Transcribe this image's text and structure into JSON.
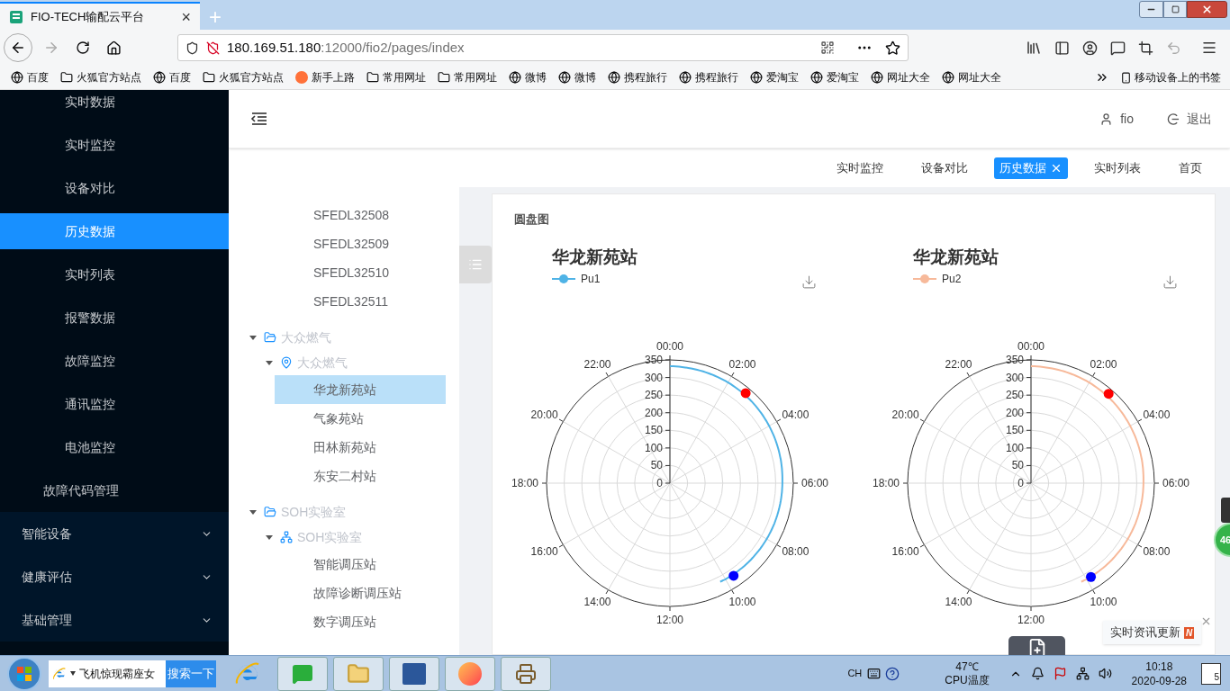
{
  "browser": {
    "tab": {
      "title": "FIO-TECH输配云平台",
      "close": "×"
    },
    "new_tab": "+",
    "url": {
      "host": "180.169.51.180",
      "path": ":12000/fio2/pages/index"
    },
    "bookmarks": [
      {
        "label": "百度",
        "kind": "globe"
      },
      {
        "label": "火狐官方站点",
        "kind": "folder"
      },
      {
        "label": "百度",
        "kind": "globe"
      },
      {
        "label": "火狐官方站点",
        "kind": "folder"
      },
      {
        "label": "新手上路",
        "kind": "firefox"
      },
      {
        "label": "常用网址",
        "kind": "folder"
      },
      {
        "label": "常用网址",
        "kind": "folder"
      },
      {
        "label": "微博",
        "kind": "globe"
      },
      {
        "label": "微博",
        "kind": "globe"
      },
      {
        "label": "携程旅行",
        "kind": "globe"
      },
      {
        "label": "携程旅行",
        "kind": "globe"
      },
      {
        "label": "爱淘宝",
        "kind": "globe"
      },
      {
        "label": "爱淘宝",
        "kind": "globe"
      },
      {
        "label": "网址大全",
        "kind": "globe"
      },
      {
        "label": "网址大全",
        "kind": "globe"
      }
    ],
    "mobile_bookmarks": "移动设备上的书签"
  },
  "sidebar": {
    "items": [
      {
        "label": "实时数据",
        "kind": "sub-item",
        "selected": false
      },
      {
        "label": "实时监控",
        "kind": "sub-item",
        "selected": false
      },
      {
        "label": "设备对比",
        "kind": "sub-item",
        "selected": false
      },
      {
        "label": "历史数据",
        "kind": "sub-item",
        "selected": true
      },
      {
        "label": "实时列表",
        "kind": "sub-item",
        "selected": false
      },
      {
        "label": "报警数据",
        "kind": "sub-item",
        "selected": false
      },
      {
        "label": "故障监控",
        "kind": "sub-item",
        "selected": false
      },
      {
        "label": "通讯监控",
        "kind": "sub-item",
        "selected": false
      },
      {
        "label": "电池监控",
        "kind": "sub-item",
        "selected": false
      },
      {
        "label": "故障代码管理",
        "kind": "item",
        "selected": false
      },
      {
        "label": "智能设备",
        "kind": "menu",
        "selected": false,
        "expanded": false
      },
      {
        "label": "健康评估",
        "kind": "menu",
        "selected": false,
        "expanded": false
      },
      {
        "label": "基础管理",
        "kind": "menu",
        "selected": false,
        "expanded": false
      }
    ]
  },
  "header": {
    "user": "fio",
    "logout": "退出"
  },
  "tags": [
    {
      "label": "实时监控",
      "selected": false
    },
    {
      "label": "设备对比",
      "selected": false
    },
    {
      "label": "历史数据",
      "selected": true
    },
    {
      "label": "实时列表",
      "selected": false
    },
    {
      "label": "首页",
      "selected": false
    }
  ],
  "tree": [
    {
      "label": "SFEDL32508",
      "kind": "leaf",
      "selected": false
    },
    {
      "label": "SFEDL32509",
      "kind": "leaf",
      "selected": false
    },
    {
      "label": "SFEDL32510",
      "kind": "leaf",
      "selected": false
    },
    {
      "label": "SFEDL32511",
      "kind": "leaf",
      "selected": false
    },
    {
      "label": "大众燃气",
      "kind": "folder",
      "expanded": true,
      "children": [
        {
          "label": "大众燃气",
          "kind": "site",
          "expanded": true,
          "children": [
            {
              "label": "华龙新苑站",
              "kind": "leaf",
              "selected": true
            },
            {
              "label": "气象苑站",
              "kind": "leaf",
              "selected": false
            },
            {
              "label": "田林新苑站",
              "kind": "leaf",
              "selected": false
            },
            {
              "label": "东安二村站",
              "kind": "leaf",
              "selected": false
            }
          ]
        }
      ]
    },
    {
      "label": "SOH实验室",
      "kind": "folder",
      "expanded": true,
      "children": [
        {
          "label": "SOH实验室",
          "kind": "lab",
          "expanded": true,
          "children": [
            {
              "label": "智能调压站",
              "kind": "leaf",
              "selected": false
            },
            {
              "label": "故障诊断调压站",
              "kind": "leaf",
              "selected": false
            },
            {
              "label": "数字调压站",
              "kind": "leaf",
              "selected": false
            }
          ]
        }
      ]
    }
  ],
  "card": {
    "title": "圆盘图",
    "charts": [
      {
        "title": "华龙新苑站",
        "legend": {
          "name": "Pu1",
          "color": "#4fb3e6"
        },
        "angle_labels": [
          "00:00",
          "02:00",
          "04:00",
          "06:00",
          "08:00",
          "10:00",
          "12:00",
          "14:00",
          "16:00",
          "18:00",
          "20:00",
          "22:00"
        ],
        "radius_labels": [
          "350",
          "300",
          "250",
          "200",
          "150",
          "100",
          "50",
          "0"
        ]
      },
      {
        "title": "华龙新苑站",
        "legend": {
          "name": "Pu2",
          "color": "#f7b99a"
        },
        "angle_labels": [
          "00:00",
          "02:00",
          "04:00",
          "06:00",
          "08:00",
          "10:00",
          "12:00",
          "14:00",
          "16:00",
          "18:00",
          "20:00",
          "22:00"
        ],
        "radius_labels": [
          "350",
          "300",
          "250",
          "200",
          "150",
          "100",
          "50",
          "0"
        ]
      }
    ]
  },
  "toast": {
    "text": "实时资讯更新",
    "badge": "N"
  },
  "floating_badge": "46",
  "taskbar": {
    "search": {
      "value": "飞机惊现霸座女",
      "button": "搜索一下"
    },
    "tray": {
      "lang": "CH",
      "temp": "47℃",
      "temp_label": "CPU温度",
      "time": "10:18",
      "date": "2020-09-28",
      "notifications": "5"
    }
  }
}
